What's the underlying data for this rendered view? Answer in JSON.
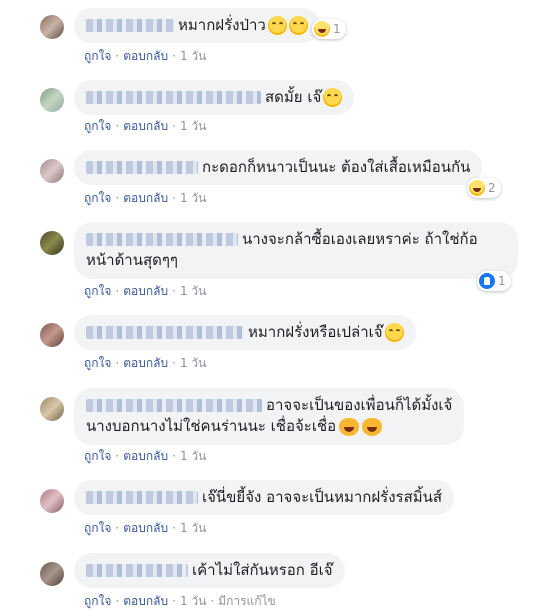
{
  "actions": {
    "like_label": "ถูกใจ",
    "reply_label": "ตอบกลับ",
    "separator": "·",
    "edited_label": "มีการแก้ไข"
  },
  "comments": [
    {
      "text": "หมากฝรั่งป่าว",
      "time": "1 วัน",
      "reaction": {
        "icon": "haha-icon",
        "count": "1"
      }
    },
    {
      "text": "สดมั้ย เจ๊",
      "time": "1 วัน"
    },
    {
      "text": "กะดอกก็หนาวเป็นนะ ต้องใส่เสื้อเหมือนกัน",
      "time": "1 วัน",
      "reaction": {
        "icon": "haha-icon",
        "count": "2"
      }
    },
    {
      "text": "นางจะกล้าซื้อเองเลยหราค่ะ ถ้าใช่ก้อ",
      "text2": "หน้าด้านสุดๆๆ",
      "time": "1 วัน",
      "reaction": {
        "icon": "like-icon",
        "count": "1"
      }
    },
    {
      "text": "หมากฝรั่งหรือเปล่าเจ๊",
      "time": "1 วัน"
    },
    {
      "text": "อาจจะเป็นของเพื่อนก็ได้มั้งเจ้",
      "text2": "นางบอกนางไม่ใช่คนร่านนะ เชื่อจ้ะเชื่อ",
      "time": "1 วัน"
    },
    {
      "text": "เจ๊นี่ขยี้จัง อาจจะเป็นหมากฝรั่งรสมิ้นส์",
      "time": "1 วัน"
    },
    {
      "text": "เค้าไม่ใส่กันหรอก อีเจ๊",
      "time": "1 วัน",
      "edited": true
    }
  ]
}
